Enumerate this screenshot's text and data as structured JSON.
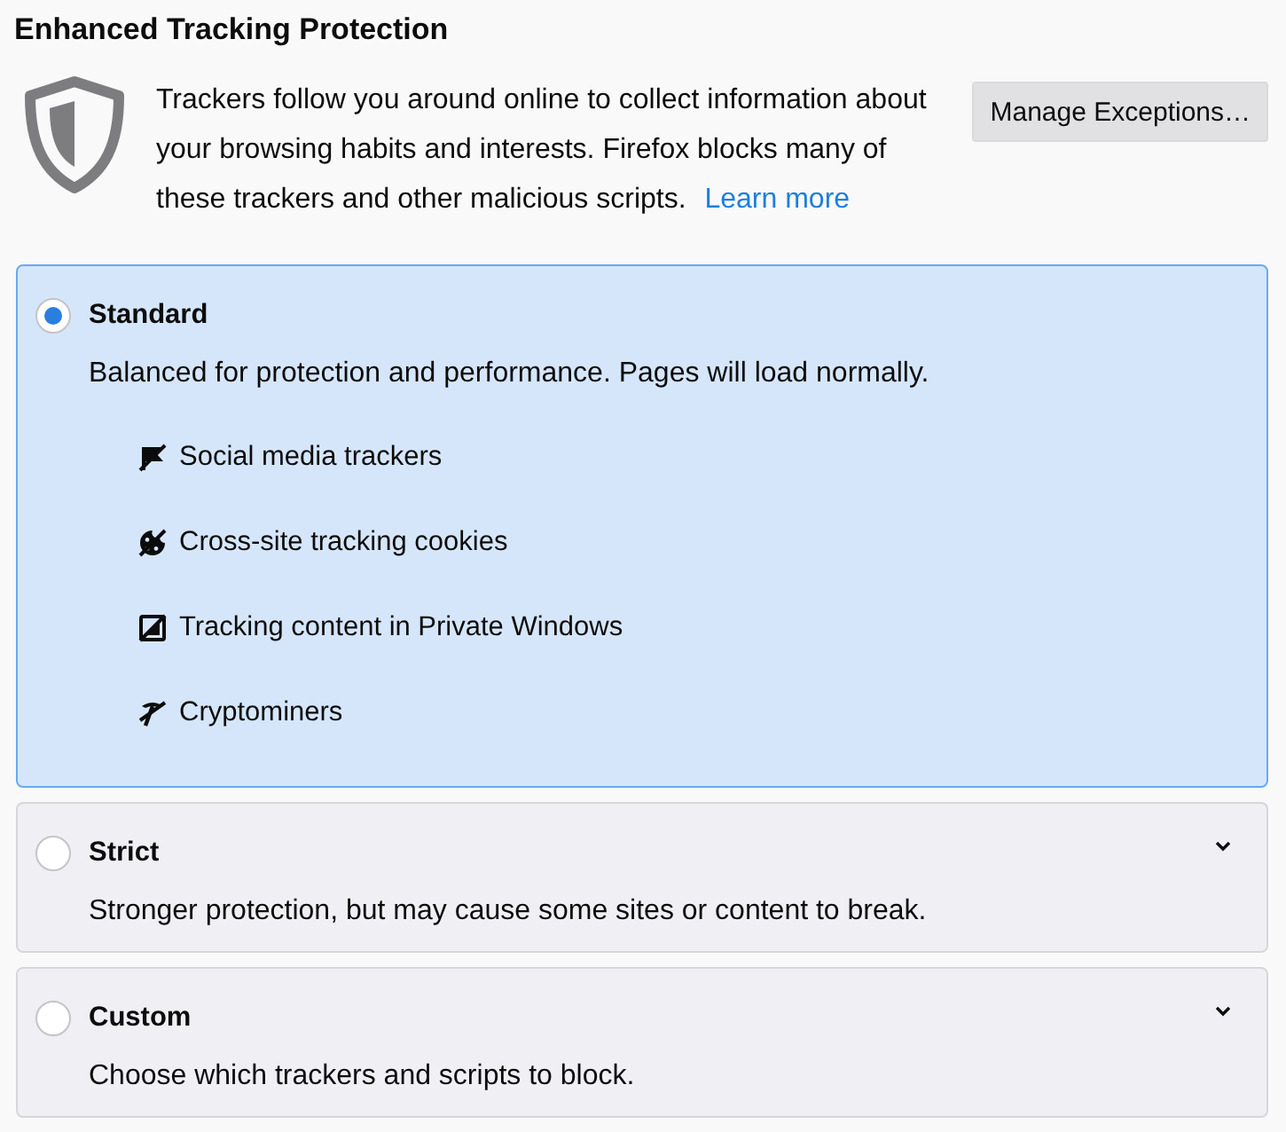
{
  "title": "Enhanced Tracking Protection",
  "intro": {
    "text": "Trackers follow you around online to collect information about your browsing habits and interests. Firefox blocks many of these trackers and other malicious scripts.",
    "link": "Learn more"
  },
  "exceptions_button": {
    "label": "Manage Exceptions…"
  },
  "options": [
    {
      "label": "Standard",
      "selected": true,
      "expanded": true,
      "description": "Balanced for protection and performance. Pages will load normally.",
      "features": [
        {
          "kind": "social",
          "label": "Social media trackers"
        },
        {
          "kind": "cookies",
          "label": "Cross-site tracking cookies"
        },
        {
          "kind": "content",
          "label": "Tracking content in Private Windows"
        },
        {
          "kind": "cryptominers",
          "label": "Cryptominers"
        }
      ]
    },
    {
      "label": "Strict",
      "selected": false,
      "expanded": false,
      "description": "Stronger protection, but may cause some sites or content to break."
    },
    {
      "label": "Custom",
      "selected": false,
      "expanded": false,
      "description": "Choose which trackers and scripts to block."
    }
  ]
}
